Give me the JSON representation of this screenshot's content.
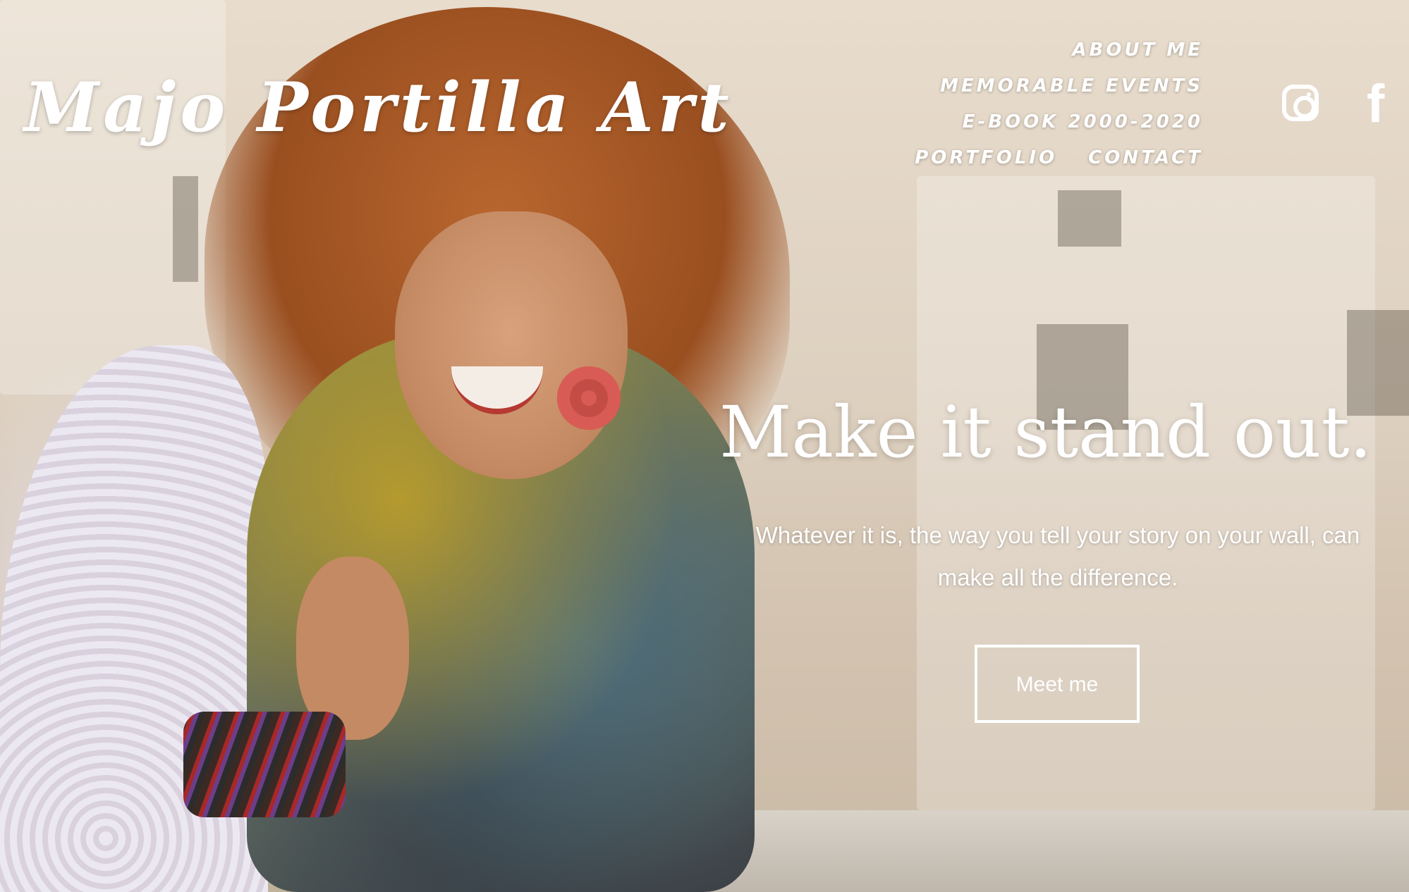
{
  "header": {
    "brand": "Majo Portilla Art"
  },
  "nav": {
    "items": [
      {
        "label": "ABOUT ME"
      },
      {
        "label": "MEMORABLE EVENTS"
      },
      {
        "label": "E-BOOK 2000-2020"
      },
      {
        "label": "PORTFOLIO"
      },
      {
        "label": "CONTACT"
      }
    ]
  },
  "social": {
    "icons": [
      "instagram-icon",
      "facebook-icon"
    ],
    "facebook_glyph": "f"
  },
  "hero": {
    "headline": "Make it stand out.",
    "subtext": "Whatever it is, the way you tell your story on your wall, can make all the difference.",
    "cta_label": "Meet me"
  },
  "colors": {
    "text": "#ffffff",
    "hair_accent": "#b8662e"
  }
}
